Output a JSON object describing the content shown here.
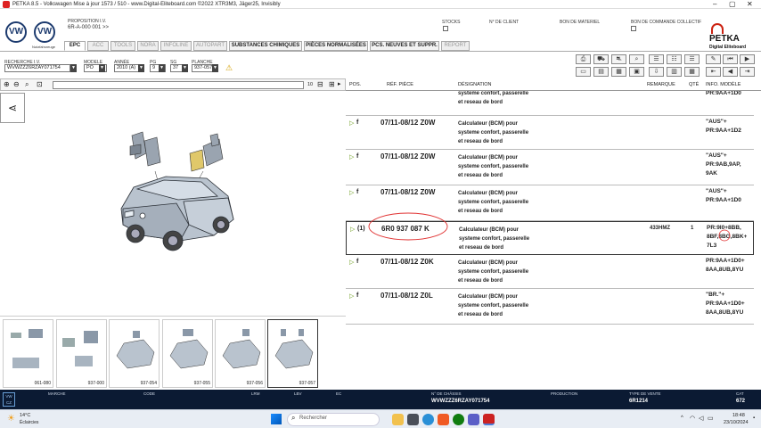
{
  "window": {
    "title": "PETKA 8.5 - Volkswagen Mise à jour 1573 / 510 - www.Digital-Eliteboard.com ©2022 XTR3M3, Jäger25, Invisibly"
  },
  "header": {
    "brand_sub": "Nutzfahrzeuge",
    "proposition_label": "PROPOSITION I.V.",
    "proposition_value": "6R-A-000 001 >>",
    "stocks_label": "STOCKS",
    "client_label": "N° DE CLIENT",
    "bon_materiel_label": "BON DE MATERIEL",
    "bon_commande_label": "BON DE COMMANDE COLLECTIF",
    "logo_main": "PETKA",
    "logo_sub": "Digital Eliteboard"
  },
  "tabs": [
    "EPC",
    "ACC",
    "TOOLS",
    "NORA",
    "INFOLINE",
    "AUTOPART",
    "SUBSTANCES CHIMIQUES",
    "PIÈCES NORMALISÉES",
    "PCS. NEUVES ET SUPPR.",
    "REPORT"
  ],
  "filters": {
    "recherche_label": "RECHERCHE I.V.",
    "recherche_value": "WVWZZZ6RZAY071754",
    "modele_label": "MODELE",
    "modele_value": "PO",
    "annee_label": "ANNÉE",
    "annee_value": "2010 (A)",
    "pg_label": "PG",
    "pg_value": "9",
    "sg_label": "SG",
    "sg_value": "37",
    "planche_label": "PLANCHE",
    "planche_value": "937-057"
  },
  "searchbar": {
    "counter": "10"
  },
  "table": {
    "headers": {
      "pos": "POS.",
      "ref": "RÉF. PIÈCE",
      "designation": "DÉSIGNATION",
      "remarque": "REMARQUE",
      "qte": "QTÉ",
      "info": "INFO. MODÈLE"
    },
    "rows": [
      {
        "pos": "",
        "ref": "",
        "des": "systeme confort, passerelle\net reseau de bord",
        "rem": "",
        "qty": "",
        "info": "PR:9AA+1D0"
      },
      {
        "pos": "f",
        "ref": "07/11-08/12 Z0W",
        "des": "Calculateur (BCM) pour\nsysteme confort, passerelle\net reseau de bord",
        "rem": "",
        "qty": "",
        "info": "\"AUS\"+\nPR:9AA+1D2"
      },
      {
        "pos": "f",
        "ref": "07/11-08/12 Z0W",
        "des": "Calculateur (BCM) pour\nsysteme confort, passerelle\net reseau de bord",
        "rem": "",
        "qty": "",
        "info": "\"AUS\"+\nPR:9AB,9AP,\n9AK"
      },
      {
        "pos": "f",
        "ref": "07/11-08/12 Z0W",
        "des": "Calculateur (BCM) pour\nsysteme confort, passerelle\net reseau de bord",
        "rem": "",
        "qty": "",
        "info": "\"AUS\"+\nPR:9AA+1D0"
      },
      {
        "pos": "(1)",
        "ref": "6R0 937 087 K",
        "des": "Calculateur (BCM) pour\nsysteme confort, passerelle\net reseau de bord",
        "rem": "433HMZ",
        "qty": "1",
        "info": "PR:9I0+8BB,\n8BF,8BG,8BK+\n7L3"
      },
      {
        "pos": "f",
        "ref": "07/11-08/12 Z0K",
        "des": "Calculateur (BCM) pour\nsysteme confort, passerelle\net reseau de bord",
        "rem": "",
        "qty": "",
        "info": "PR:9AA+1D0+\n8AA,8UB,8YU"
      },
      {
        "pos": "f",
        "ref": "07/11-08/12 Z0L",
        "des": "Calculateur (BCM) pour\nsysteme confort, passerelle\net reseau de bord",
        "rem": "",
        "qty": "",
        "info": "\"BR.\"+\nPR:9AA+1D0+\n8AA,8UB,8YU"
      }
    ]
  },
  "thumbnails": [
    "061-080",
    "937-000",
    "937-054",
    "937-055",
    "937-056",
    "937-057"
  ],
  "statusbar": {
    "marche_label": "MARCHE",
    "code_label": "CODE",
    "lrm_label": "LRM",
    "lbv_label": "LBV",
    "ec_label": "EC",
    "chassis_label": "N° DE CHÂSSIS",
    "chassis_value": "WVWZZZ6RZAY071754",
    "production_label": "PRODUCTION",
    "type_label": "TYPE DE VENTE",
    "type_value": "6R1214",
    "cat_label": "CAT",
    "cat_value": "672",
    "left_text": "VW\nCZ"
  },
  "taskbar": {
    "weather_temp": "14°C",
    "weather_desc": "Éclaircies",
    "search_placeholder": "Rechercher",
    "time": "18:48",
    "date": "23/10/2024"
  },
  "colors": {
    "status_bg": "#0b1a33",
    "arrow_green": "#6a9b1a",
    "highlight_red": "#e03030",
    "vw_blue": "#1c3a6e"
  }
}
